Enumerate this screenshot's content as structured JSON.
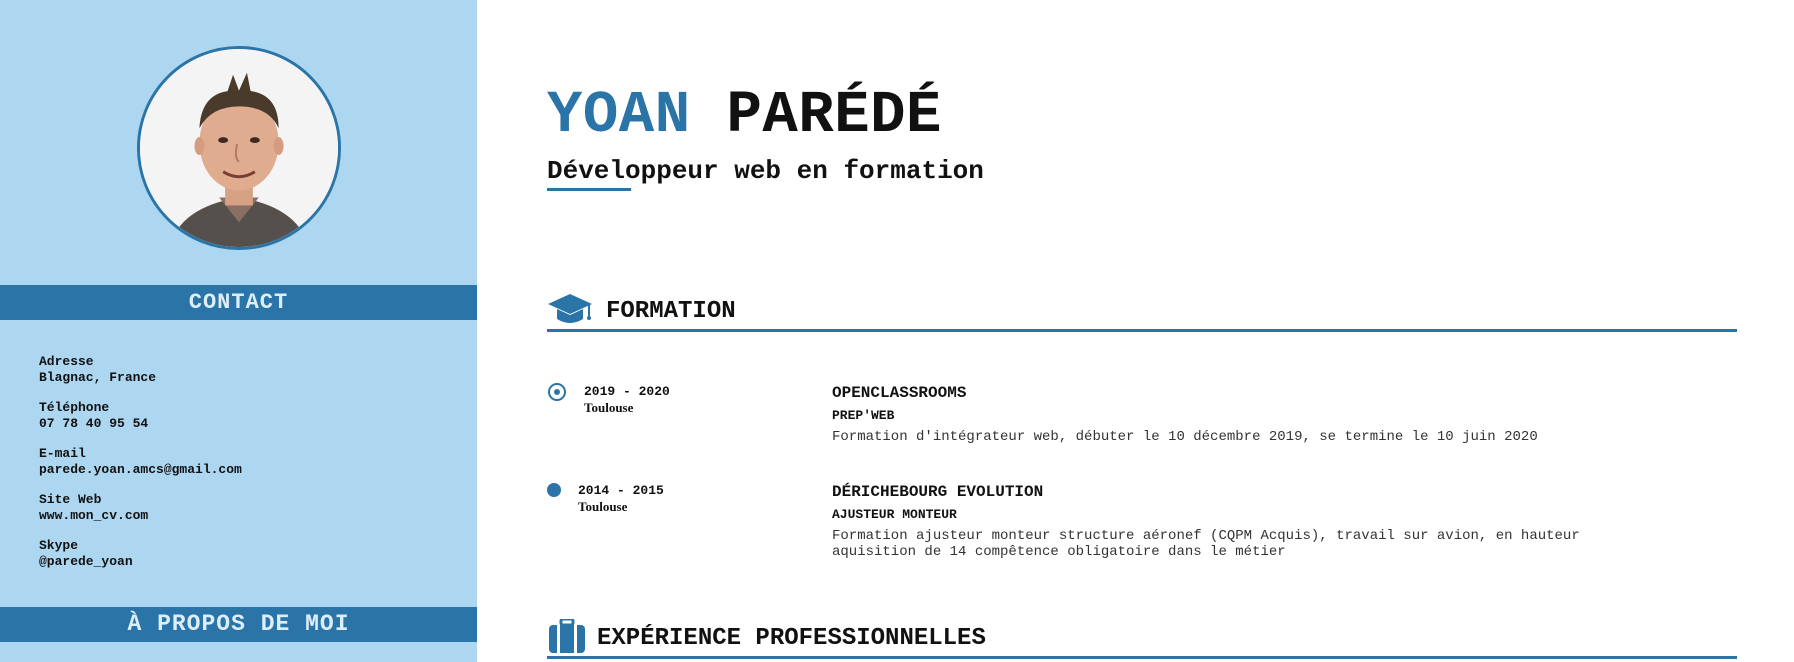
{
  "sidebar": {
    "photo_alt": "Yoan Parédé",
    "contact_title": "CONTACT",
    "contact_items": [
      {
        "label": "Adresse",
        "value": "Blagnac, France"
      },
      {
        "label": "Téléphone",
        "value": "07 78 40 95 54"
      },
      {
        "label": "E-mail",
        "value": "parede.yoan.amcs@gmail.com"
      },
      {
        "label": "Site Web",
        "value": "www.mon_cv.com"
      },
      {
        "label": "Skype",
        "value": "@parede_yoan"
      }
    ],
    "about_title": "À PROPOS DE MOI"
  },
  "header": {
    "first_name": "YOAN",
    "last_name": "PARÉDÉ",
    "subtitle": "Développeur web en formation"
  },
  "formation": {
    "title": "FORMATION",
    "icon": "graduation-cap-icon",
    "entries": [
      {
        "years": "2019 - 2020",
        "location": "Toulouse",
        "organization": "OPENCLASSROOMS",
        "role": "PREP'WEB",
        "description_lines": [
          "Formation d'intégrateur web, débuter le 10 décembre 2019, se termine le 10 juin 2020"
        ]
      },
      {
        "years": "2014 - 2015",
        "location": "Toulouse",
        "organization": "DÉRICHEBOURG EVOLUTION",
        "role": "AJUSTEUR MONTEUR",
        "description_lines": [
          "Formation ajusteur monteur structure aéronef (CQPM Acquis), travail sur avion, en hauteur",
          "aquisition de 14 compêtence obligatoire dans le métier"
        ]
      }
    ]
  },
  "experience": {
    "title": "EXPÉRIENCE PROFESSIONNELLES",
    "icon": "briefcase-icon"
  },
  "colors": {
    "accent": "#2a74a8",
    "sidebar_bg": "#add6f1",
    "band_text": "#ddeefb"
  }
}
